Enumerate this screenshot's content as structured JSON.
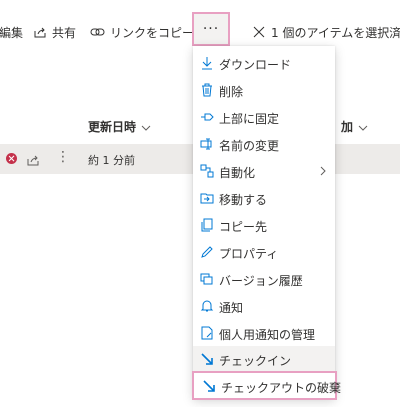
{
  "command_bar": {
    "edit_label": "編集",
    "share_label": "共有",
    "copy_link_label": "リンクをコピー",
    "more_label": "···",
    "selection_label": "1 個のアイテムを選択済み"
  },
  "list": {
    "column_modified": "更新日時",
    "column_added": "加",
    "rows": [
      {
        "modified": "約 1 分前"
      }
    ]
  },
  "menu": {
    "items": [
      {
        "label": "ダウンロード",
        "icon": "download-icon"
      },
      {
        "label": "削除",
        "icon": "delete-icon"
      },
      {
        "label": "上部に固定",
        "icon": "pin-icon"
      },
      {
        "label": "名前の変更",
        "icon": "rename-icon"
      },
      {
        "label": "自動化",
        "icon": "automate-icon"
      },
      {
        "label": "移動する",
        "icon": "move-icon"
      },
      {
        "label": "コピー先",
        "icon": "copy-icon"
      },
      {
        "label": "プロパティ",
        "icon": "properties-icon"
      },
      {
        "label": "バージョン履歴",
        "icon": "version-history-icon"
      },
      {
        "label": "通知",
        "icon": "bell-icon"
      },
      {
        "label": "個人用通知の管理",
        "icon": "manage-alerts-icon"
      },
      {
        "label": "チェックイン",
        "icon": "check-in-icon"
      },
      {
        "label": "チェックアウトの破棄",
        "icon": "discard-checkout-icon"
      }
    ]
  },
  "colors": {
    "accent": "#0078d4",
    "highlight_border": "#e8a0c2",
    "error": "#c4314b"
  }
}
